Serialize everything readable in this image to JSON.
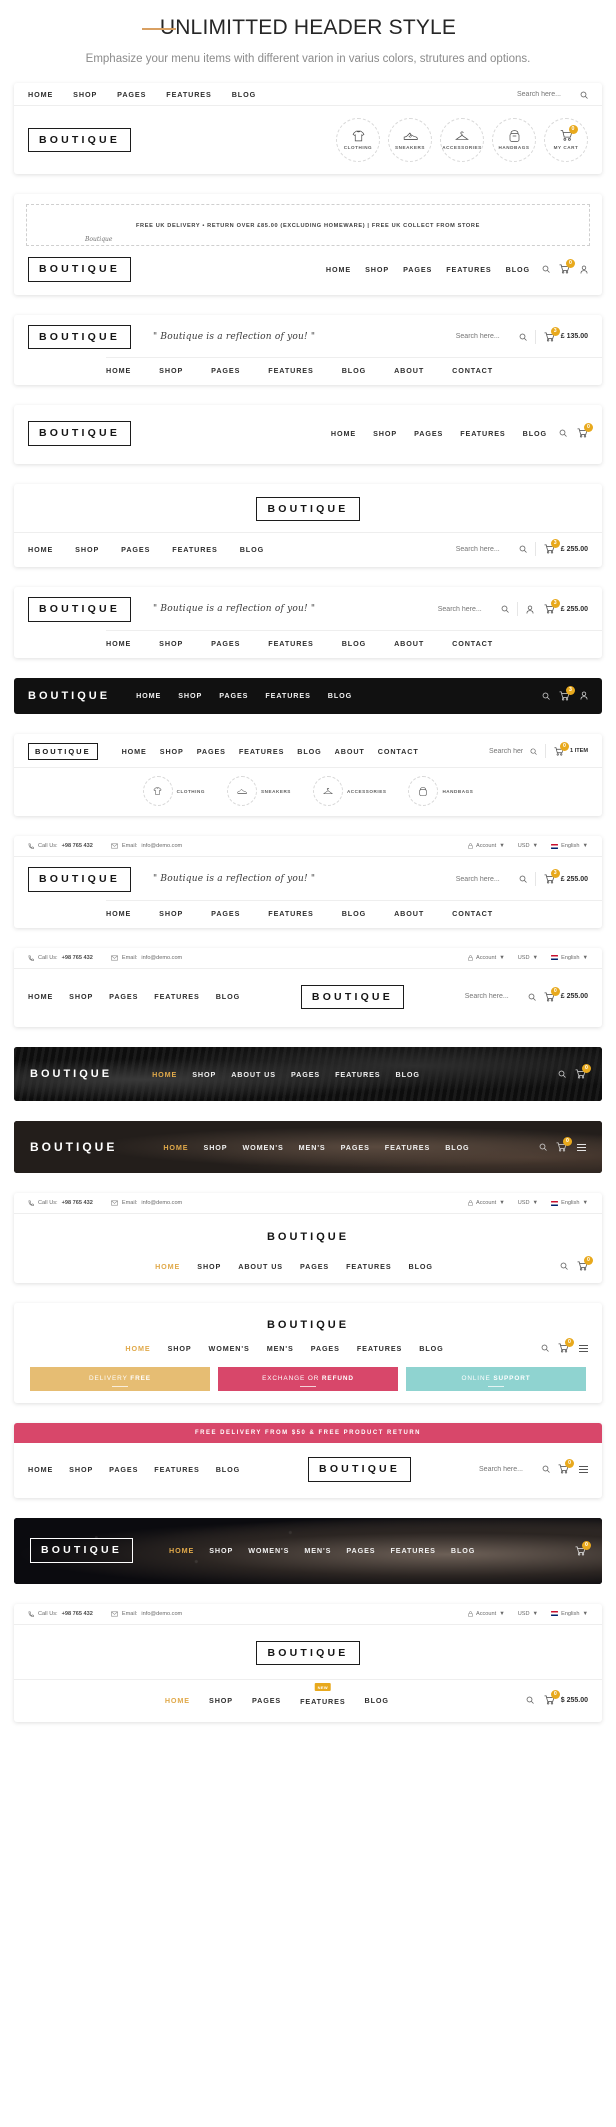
{
  "intro": {
    "title": "UNLIMITTED HEADER STYLE",
    "subtitle": "Emphasize your menu items with different varion in varius colors, strutures and options."
  },
  "brand": {
    "name": "BOUTIQUE",
    "accent": "#e8a91d",
    "pink": "#d8476a",
    "teal": "#8fd3d0",
    "gold": "#e6bd73"
  },
  "common": {
    "nav_basic": [
      "HOME",
      "SHOP",
      "PAGES",
      "FEATURES",
      "BLOG"
    ],
    "nav_full": [
      "HOME",
      "SHOP",
      "PAGES",
      "FEATURES",
      "BLOG",
      "ABOUT",
      "CONTACT"
    ],
    "nav_womens": [
      "HOME",
      "SHOP",
      "WOMEN'S",
      "MEN'S",
      "PAGES",
      "FEATURES",
      "BLOG"
    ],
    "nav_about": [
      "HOME",
      "SHOP",
      "ABOUT US",
      "PAGES",
      "FEATURES",
      "BLOG"
    ],
    "search_placeholder": "Search here...",
    "tagline": "\" Boutique is a reflection of you! \"",
    "cart_count_3": "3",
    "cart_count_0": "0",
    "price": "£ 255.00",
    "price_alt": "$ 255.00",
    "price_block1": "£ 135.00"
  },
  "topbar": {
    "call_label": "Call Us:",
    "call_value": "+98 765 432",
    "email_label": "Email:",
    "email_value": "info@demo.com",
    "account": "Account",
    "currency": "USD",
    "language": "English"
  },
  "block1": {
    "categories": [
      {
        "label": "CLOTHING",
        "icon": "tshirt-icon"
      },
      {
        "label": "SNEAKERS",
        "icon": "sneaker-icon"
      },
      {
        "label": "ACCESSORIES",
        "icon": "hanger-icon"
      },
      {
        "label": "HANDBAGS",
        "icon": "handbag-icon"
      },
      {
        "label": "MY CART",
        "icon": "cart-icon"
      }
    ],
    "cart_count": "0"
  },
  "block2": {
    "notice": "FREE UK DELIVERY • RETURN OVER £85.00 (EXCLUDING HOMEWARE) | FREE UK COLLECT FROM STORE",
    "signature": "Boutique"
  },
  "block8": {
    "categories": [
      {
        "label": "CLOTHING",
        "icon": "tshirt-icon"
      },
      {
        "label": "SNEAKERS",
        "icon": "sneaker-icon"
      },
      {
        "label": "ACCESSORIES",
        "icon": "hanger-icon"
      },
      {
        "label": "HANDBAGS",
        "icon": "handbag-icon"
      }
    ],
    "cart_text": "1 ITEM"
  },
  "block_buttons": {
    "items": [
      {
        "pre": "DELIVERY ",
        "strong": "FREE",
        "color": "#e6bd73"
      },
      {
        "pre": "EXCHANGE OR ",
        "strong": "REFUND",
        "color": "#d8476a"
      },
      {
        "pre": "ONLINE ",
        "strong": "SUPPORT",
        "color": "#8fd3d0"
      }
    ]
  },
  "block_pink": {
    "banner": "FREE DELIVERY FROM $50 & FREE PRODUCT RETURN"
  },
  "block_last": {
    "new_badge": "NEW"
  }
}
